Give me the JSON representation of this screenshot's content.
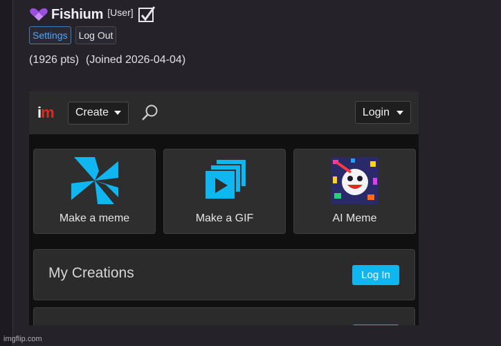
{
  "profile": {
    "username": "Fishium",
    "role": "[User]",
    "settings_label": "Settings",
    "logout_label": "Log Out",
    "points": "(1926 pts)",
    "joined": "(Joined 2026-04-04)",
    "heart_icon": "purple-heart-icon",
    "check_icon": "checkbox-check-icon"
  },
  "embed": {
    "logo_i": "i",
    "logo_m": "m",
    "create_label": "Create",
    "login_label": "Login",
    "tiles": [
      {
        "label": "Make a meme",
        "icon": "pinwheel-icon"
      },
      {
        "label": "Make a GIF",
        "icon": "gif-stack-icon"
      },
      {
        "label": "AI Meme",
        "icon": "ai-meme-thumbnail"
      }
    ],
    "creations_title": "My Creations",
    "creations_button": "Log In"
  },
  "watermark": "imgflip.com",
  "colors": {
    "accent_blue": "#10b6ef",
    "logo_red": "#e0281e",
    "link_blue": "#4aa8ff",
    "heart_purple": "#9b4fe0"
  }
}
